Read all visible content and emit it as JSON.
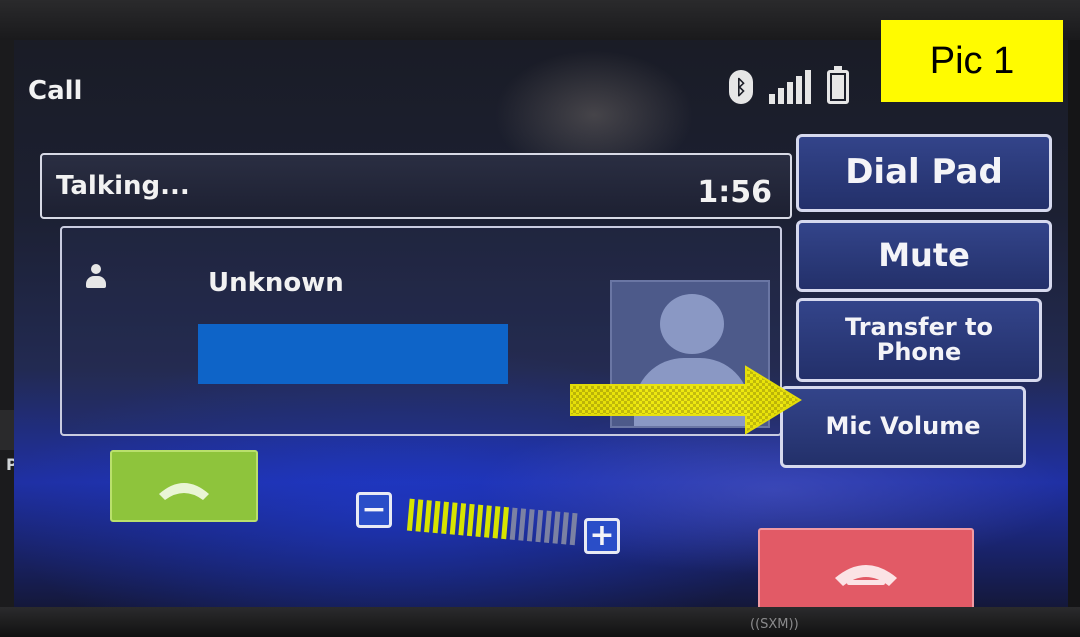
{
  "screen": {
    "title": "Call",
    "status_icons": [
      "bluetooth-icon",
      "signal-icon",
      "battery-icon"
    ],
    "call_status": {
      "label": "Talking...",
      "timer": "1:56"
    },
    "contact": {
      "name": "Unknown",
      "number_redacted": true
    },
    "buttons": {
      "dial_pad": "Dial Pad",
      "mute": "Mute",
      "transfer": "Transfer to Phone",
      "mic_volume": "Mic Volume"
    },
    "volume": {
      "minus": "−",
      "plus": "+",
      "level": 12,
      "max": 20
    },
    "colors": {
      "accept": "#8ec43c",
      "end": "#e25a66",
      "button": "#2a3a7e",
      "volume_on": "#d7e400",
      "volume_off": "#7b81a3",
      "highlight": "#fffb00"
    }
  },
  "annotation": {
    "pic_label": "Pic 1"
  },
  "device": {
    "side_label": "PS",
    "brand_label": "((SXM))"
  }
}
